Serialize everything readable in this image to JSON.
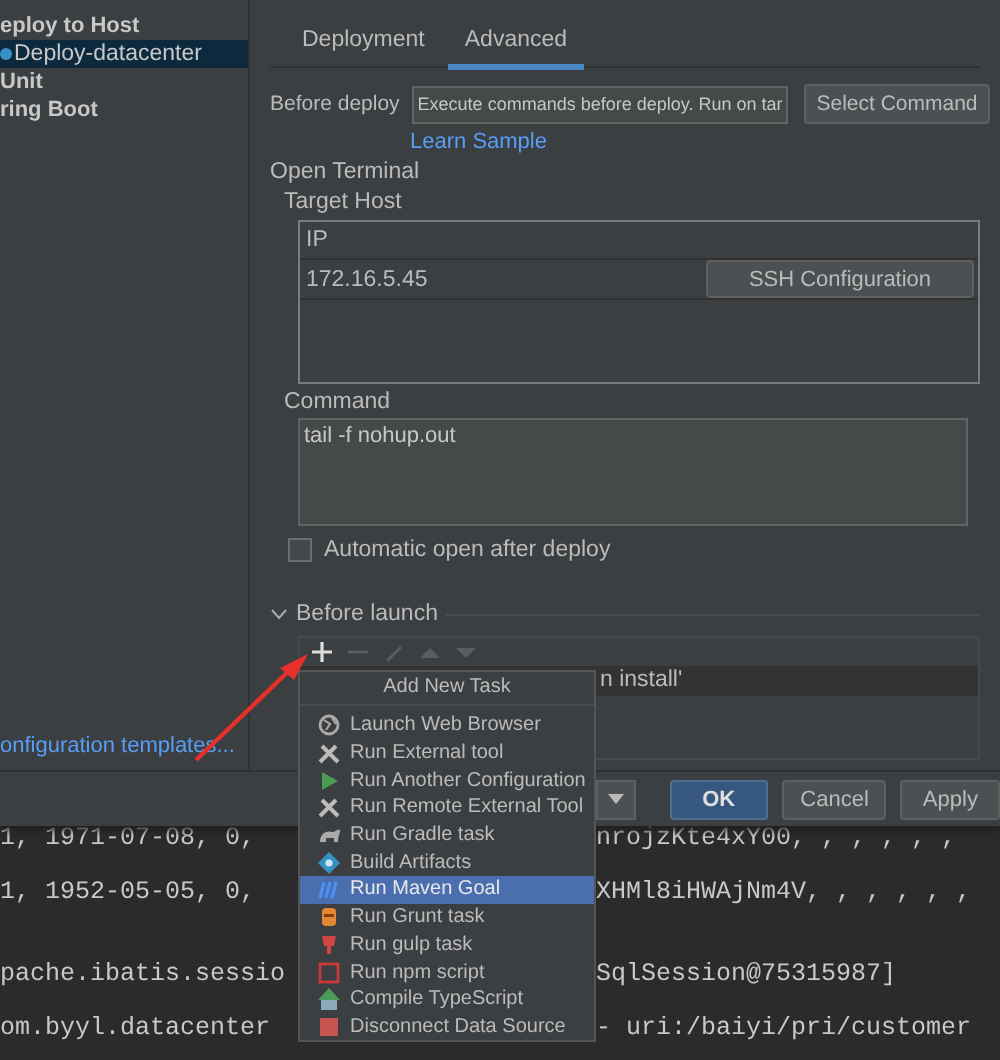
{
  "sidebar": {
    "items": [
      {
        "label": "eploy to Host",
        "selected": false,
        "children": [
          {
            "label": "Deploy-datacenter",
            "selected": true
          }
        ]
      },
      {
        "label": "Unit",
        "selected": false
      },
      {
        "label": "ring Boot",
        "selected": false
      }
    ],
    "templates_link": "onfiguration templates..."
  },
  "tabs": [
    {
      "label": "Deployment",
      "selected": false
    },
    {
      "label": "Advanced",
      "selected": true
    }
  ],
  "before_deploy": {
    "label": "Before deploy",
    "value": "Execute commands before deploy. Run on tar",
    "button": "Select Command"
  },
  "learn_link": "Learn Sample",
  "open_terminal": "Open Terminal",
  "target_host": {
    "label": "Target Host",
    "column": "IP",
    "rows": [
      {
        "ip": "172.16.5.45",
        "button": "SSH Configuration"
      }
    ]
  },
  "command": {
    "label": "Command",
    "value": "tail -f nohup.out"
  },
  "auto_open": {
    "label": "Automatic open after deploy",
    "checked": false
  },
  "before_launch": {
    "label": "Before launch",
    "expanded": true,
    "toolbar": [
      {
        "kind": "add",
        "disabled": false
      },
      {
        "kind": "remove",
        "disabled": true
      },
      {
        "kind": "edit",
        "disabled": true
      },
      {
        "kind": "up",
        "disabled": true
      },
      {
        "kind": "down",
        "disabled": true
      }
    ],
    "rows": [
      "n install'"
    ]
  },
  "popup": {
    "title": "Add New Task",
    "items": [
      {
        "label": "Launch Web Browser",
        "kind": "globe",
        "selected": false
      },
      {
        "label": "Run External tool",
        "kind": "tools",
        "selected": false
      },
      {
        "label": "Run Another Configuration",
        "kind": "play",
        "selected": false
      },
      {
        "label": "Run Remote External Tool",
        "kind": "tools",
        "selected": false
      },
      {
        "label": "Run Gradle task",
        "kind": "gradle",
        "selected": false
      },
      {
        "label": "Build Artifacts",
        "kind": "artifact",
        "selected": false
      },
      {
        "label": "Run Maven Goal",
        "kind": "maven",
        "selected": true
      },
      {
        "label": "Run Grunt task",
        "kind": "grunt",
        "selected": false
      },
      {
        "label": "Run gulp task",
        "kind": "gulp",
        "selected": false
      },
      {
        "label": "Run npm script",
        "kind": "npm",
        "selected": false
      },
      {
        "label": "Compile TypeScript",
        "kind": "typescript",
        "selected": false
      },
      {
        "label": "Disconnect Data Source",
        "kind": "disconnect",
        "selected": false
      }
    ]
  },
  "buttons": [
    {
      "label": "OK",
      "kind": "primary"
    },
    {
      "label": "Cancel",
      "kind": "plain"
    },
    {
      "label": "Apply",
      "kind": "plain"
    }
  ],
  "console": [
    {
      "left": "1, 1971-07-08, 0,",
      "right": "nrojzKte4xY00, , , , , ,",
      "gap_before": false
    },
    {
      "left": "1, 1952-05-05, 0,",
      "right": "XHMl8iHWAjNm4V, , , , , ,",
      "gap_before": false
    },
    {
      "left": "pache.ibatis.sessio",
      "right": "SqlSession@75315987]",
      "gap_before": true
    },
    {
      "left": "om.byyl.datacenter",
      "right": "- uri:/baiyi/pri/customer",
      "gap_before": false
    }
  ]
}
